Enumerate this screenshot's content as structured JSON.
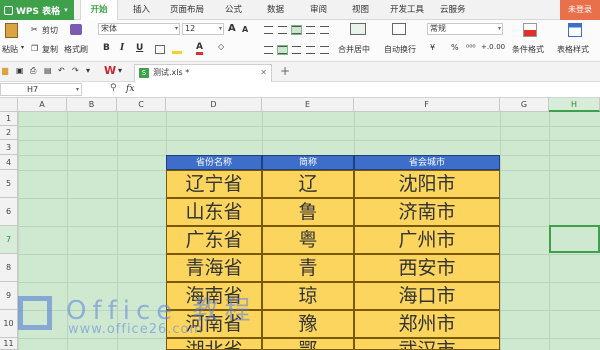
{
  "app": {
    "name": "WPS 表格",
    "login": "未登录"
  },
  "menu": [
    "开始",
    "插入",
    "页面布局",
    "公式",
    "数据",
    "审阅",
    "视图",
    "开发工具",
    "云服务"
  ],
  "ribbon": {
    "paste": "粘贴",
    "cut": "剪切",
    "copy": "复制",
    "format_painter": "格式刷",
    "font_name": "宋体",
    "font_size": "12",
    "merge_center": "合并居中",
    "wrap_text": "自动换行",
    "number_format": "常规",
    "conditional_format": "条件格式",
    "table_style": "表格样式",
    "bold": "B",
    "italic": "I",
    "underline": "U",
    "font_grow": "A",
    "font_shrink": "A",
    "currency": "¥",
    "percent": "%"
  },
  "document": {
    "tab_title": "测试.xls *"
  },
  "formula_bar": {
    "cell_ref": "H7",
    "fx": "fx",
    "value": ""
  },
  "columns": [
    "A",
    "B",
    "C",
    "D",
    "E",
    "F",
    "G",
    "H"
  ],
  "rows": [
    "1",
    "2",
    "3",
    "4",
    "5",
    "6",
    "7",
    "8",
    "9",
    "10",
    "11"
  ],
  "table": {
    "headers": [
      "省份名称",
      "简称",
      "省会城市"
    ],
    "rows": [
      [
        "辽宁省",
        "辽",
        "沈阳市"
      ],
      [
        "山东省",
        "鲁",
        "济南市"
      ],
      [
        "广东省",
        "粤",
        "广州市"
      ],
      [
        "青海省",
        "青",
        "西安市"
      ],
      [
        "海南省",
        "琼",
        "海口市"
      ],
      [
        "河南省",
        "豫",
        "郑州市"
      ],
      [
        "湖北省",
        "鄂",
        "武汉市"
      ]
    ]
  },
  "watermark": {
    "brand": "Office 教程",
    "url": "www.office26.com"
  },
  "colors": {
    "accent": "#3ea04b",
    "header_fill": "#3d6ec9",
    "cell_fill": "#fcd55e",
    "sheet_bg": "#cfe8d0"
  }
}
